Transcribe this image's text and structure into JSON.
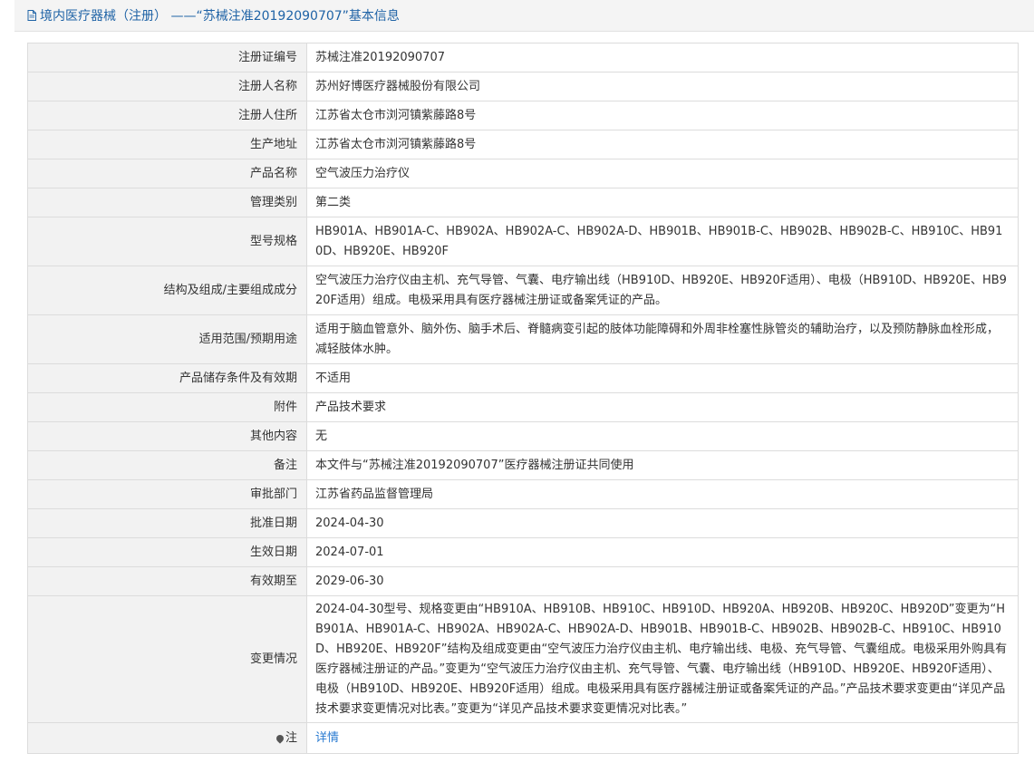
{
  "header": {
    "title": "境内医疗器械（注册） ——“苏械注准20192090707”基本信息",
    "icon": "document-icon"
  },
  "rows": [
    {
      "label": "注册证编号",
      "value": "苏械注准20192090707"
    },
    {
      "label": "注册人名称",
      "value": "苏州好博医疗器械股份有限公司"
    },
    {
      "label": "注册人住所",
      "value": "江苏省太仓市浏河镇紫藤路8号"
    },
    {
      "label": "生产地址",
      "value": "江苏省太仓市浏河镇紫藤路8号"
    },
    {
      "label": "产品名称",
      "value": "空气波压力治疗仪"
    },
    {
      "label": "管理类别",
      "value": "第二类"
    },
    {
      "label": "型号规格",
      "value": "HB901A、HB901A-C、HB902A、HB902A-C、HB902A-D、HB901B、HB901B-C、HB902B、HB902B-C、HB910C、HB910D、HB920E、HB920F"
    },
    {
      "label": "结构及组成/主要组成成分",
      "value": "空气波压力治疗仪由主机、充气导管、气囊、电疗输出线（HB910D、HB920E、HB920F适用）、电极（HB910D、HB920E、HB920F适用）组成。电极采用具有医疗器械注册证或备案凭证的产品。"
    },
    {
      "label": "适用范围/预期用途",
      "value": "适用于脑血管意外、脑外伤、脑手术后、脊髓病变引起的肢体功能障碍和外周非栓塞性脉管炎的辅助治疗，以及预防静脉血栓形成，减轻肢体水肿。"
    },
    {
      "label": "产品储存条件及有效期",
      "value": "不适用"
    },
    {
      "label": "附件",
      "value": "产品技术要求"
    },
    {
      "label": "其他内容",
      "value": "无"
    },
    {
      "label": "备注",
      "value": "本文件与“苏械注准20192090707”医疗器械注册证共同使用"
    },
    {
      "label": "审批部门",
      "value": "江苏省药品监督管理局"
    },
    {
      "label": "批准日期",
      "value": "2024-04-30"
    },
    {
      "label": "生效日期",
      "value": "2024-07-01"
    },
    {
      "label": "有效期至",
      "value": "2029-06-30"
    },
    {
      "label": "变更情况",
      "value": "2024-04-30型号、规格变更由“HB910A、HB910B、HB910C、HB910D、HB920A、HB920B、HB920C、HB920D”变更为“HB901A、HB901A-C、HB902A、HB902A-C、HB902A-D、HB901B、HB901B-C、HB902B、HB902B-C、HB910C、HB910D、HB920E、HB920F”结构及组成变更由“空气波压力治疗仪由主机、电疗输出线、电极、充气导管、气囊组成。电极采用外购具有医疗器械注册证的产品。”变更为“空气波压力治疗仪由主机、充气导管、气囊、电疗输出线（HB910D、HB920E、HB920F适用）、电极（HB910D、HB920E、HB920F适用）组成。电极采用具有医疗器械注册证或备案凭证的产品。”产品技术要求变更由“详见产品技术要求变更情况对比表。”变更为“详见产品技术要求变更情况对比表。”"
    }
  ],
  "note": {
    "label": "注",
    "icon": "pin-icon",
    "link": "详情"
  }
}
